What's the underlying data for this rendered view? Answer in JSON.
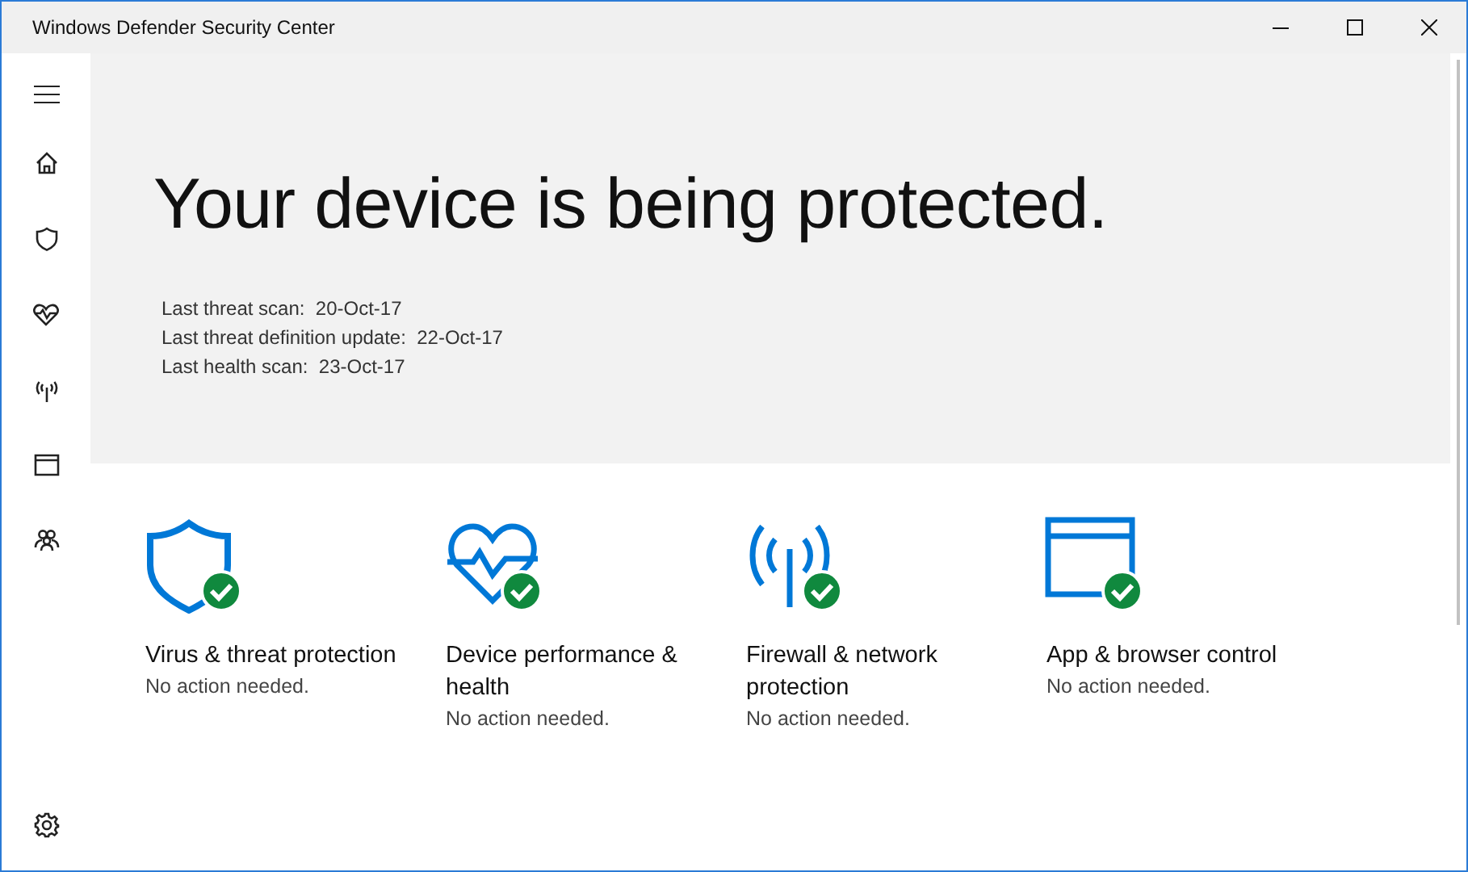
{
  "window": {
    "title": "Windows Defender Security Center"
  },
  "sidebar": {
    "items": [
      {
        "kind": "home"
      },
      {
        "kind": "shield"
      },
      {
        "kind": "health"
      },
      {
        "kind": "network"
      },
      {
        "kind": "browser"
      },
      {
        "kind": "family"
      }
    ],
    "footer": {
      "kind": "settings"
    }
  },
  "hero": {
    "title": "Your device is being protected.",
    "scans": [
      {
        "label": "Last threat scan:",
        "value": "20-Oct-17"
      },
      {
        "label": "Last threat definition update:",
        "value": "22-Oct-17"
      },
      {
        "label": "Last health scan:",
        "value": "23-Oct-17"
      }
    ]
  },
  "cards": [
    {
      "kind": "shield",
      "title": "Virus & threat protection",
      "status": "No action needed.",
      "ok": true
    },
    {
      "kind": "health",
      "title": "Device performance & health",
      "status": "No action needed.",
      "ok": true
    },
    {
      "kind": "network",
      "title": "Firewall & network protection",
      "status": "No action needed.",
      "ok": true
    },
    {
      "kind": "browser",
      "title": "App & browser control",
      "status": "No action needed.",
      "ok": true
    }
  ]
}
